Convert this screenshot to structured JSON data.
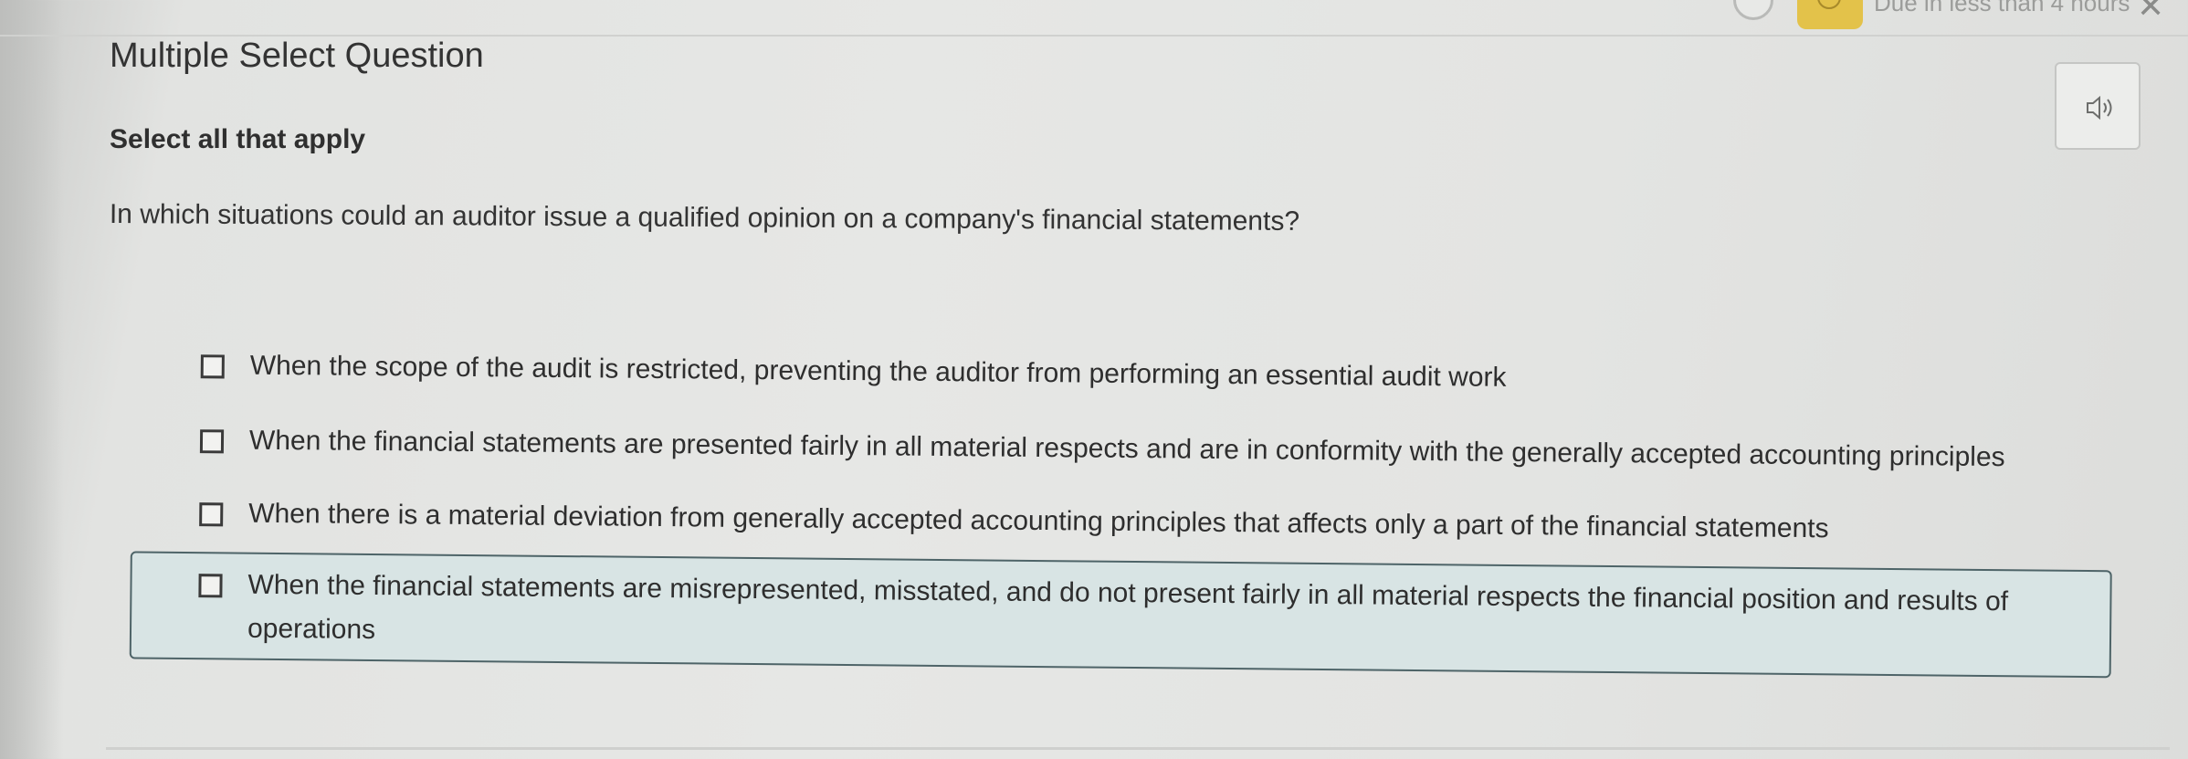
{
  "header": {
    "due_text": "Due in less than 4 hours",
    "close_glyph": "✕"
  },
  "question": {
    "type_label": "Multiple Select Question",
    "instruction": "Select all that apply",
    "prompt": "In which situations could an auditor issue a qualified opinion on a company's financial statements?"
  },
  "options": [
    {
      "label": "When the scope of the audit is restricted, preventing the auditor from performing an essential audit work",
      "checked": false
    },
    {
      "label": "When the financial statements are presented fairly in all material respects and are in conformity with the generally accepted accounting principles",
      "checked": false
    },
    {
      "label": "When there is a material deviation from generally accepted accounting principles that affects only a part of the financial statements",
      "checked": false
    },
    {
      "label": "When the financial statements are misrepresented, misstated, and do not present fairly in all material respects the financial position and results of operations",
      "checked": false,
      "hovered": true
    }
  ],
  "icons": {
    "audio": "speaker-icon",
    "checkbox": "checkbox-icon",
    "close": "close-icon"
  },
  "colors": {
    "due_badge": "#e3c24a",
    "hover_fill": "#d8e4e4",
    "hover_border": "#4e6468"
  }
}
